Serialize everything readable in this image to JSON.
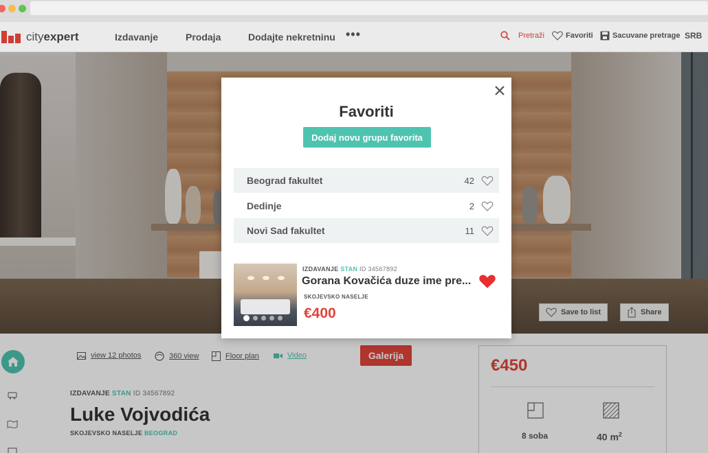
{
  "header": {
    "logo_text_light": "city",
    "logo_text_bold": "expert",
    "nav": [
      "Izdavanje",
      "Prodaja",
      "Dodajte nekretninu"
    ],
    "more": "•••",
    "search": "Pretraži",
    "favorites": "Favoriti",
    "saved_searches": "Sacuvane pretrage",
    "language": "SRB"
  },
  "hero": {
    "save_to_list": "Save to list",
    "share": "Share"
  },
  "listing": {
    "media": [
      "view 12 photos",
      "360 view",
      "Floor plan",
      "Video"
    ],
    "gallery_button": "Galerija",
    "type": "IZDAVANJE",
    "category": "STAN",
    "id_label": "ID 34567892",
    "title": "Luke Vojvodića",
    "neighborhood": "SKOJEVSKO NASELJE",
    "city": "BEOGRAD",
    "price": "€450",
    "rooms": "8 soba",
    "area": "40 m",
    "area_unit_sup": "2"
  },
  "modal": {
    "title": "Favoriti",
    "add_group_button": "Dodaj novu grupu favorita",
    "groups": [
      {
        "name": "Beograd fakultet",
        "count": "42"
      },
      {
        "name": "Dedinje",
        "count": "2"
      },
      {
        "name": "Novi Sad fakultet",
        "count": "11"
      }
    ],
    "item": {
      "type": "IZDAVANJE",
      "category": "STAN",
      "id_label": "ID 34567892",
      "title": "Gorana Kovačića duze ime pre...",
      "location": "SKOJEVSKO NASELJE",
      "price": "€400"
    }
  },
  "colors": {
    "accent": "#4ec3b0",
    "brand_red": "#e0443a"
  }
}
